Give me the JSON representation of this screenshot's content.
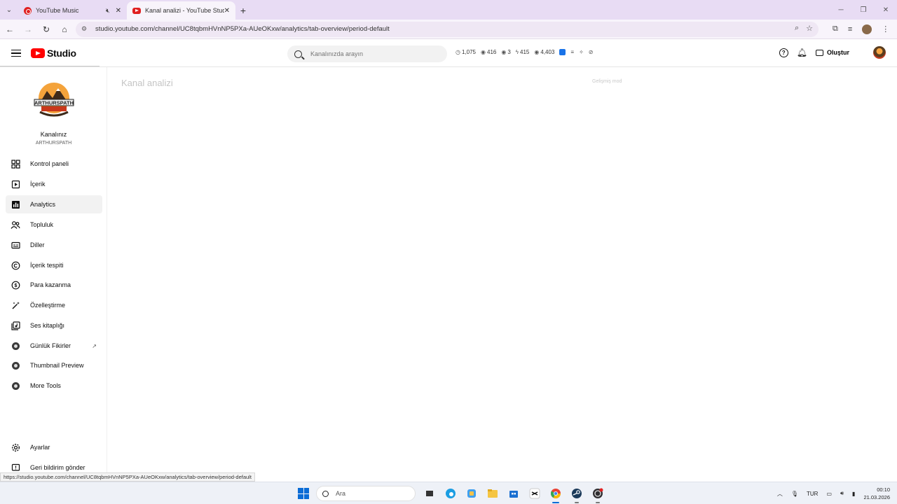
{
  "browser": {
    "tabs": [
      {
        "title": "YouTube Music",
        "icon": "youtube-music-icon",
        "muted": true
      },
      {
        "title": "Kanal analizi - YouTube Studio",
        "icon": "youtube-icon",
        "active": true
      }
    ],
    "url": "studio.youtube.com/channel/UC8tqbmHVnNP5PXa-AUeOKxw/analytics/tab-overview/period-default"
  },
  "studio": {
    "logo_text": "Studio",
    "search_placeholder": "Kanalınızda arayın",
    "stats": [
      {
        "icon": "clock-icon",
        "value": "1,075"
      },
      {
        "icon": "eye-icon",
        "value": "416"
      },
      {
        "icon": "eye-icon",
        "value": "3"
      },
      {
        "icon": "bolt-icon",
        "value": "415"
      },
      {
        "icon": "eye-icon",
        "value": "4,403"
      }
    ],
    "create_label": "Oluştur"
  },
  "sidebar": {
    "channel_title": "Kanalınız",
    "channel_handle": "ARTHURSPATH",
    "logo_text": "ARTHURSPATH",
    "items": [
      {
        "label": "Kontrol paneli",
        "icon": "dashboard-icon"
      },
      {
        "label": "İçerik",
        "icon": "content-icon"
      },
      {
        "label": "Analytics",
        "icon": "analytics-icon",
        "active": true
      },
      {
        "label": "Topluluk",
        "icon": "community-icon"
      },
      {
        "label": "Diller",
        "icon": "subtitles-icon"
      },
      {
        "label": "İçerik tespiti",
        "icon": "copyright-icon"
      },
      {
        "label": "Para kazanma",
        "icon": "dollar-icon"
      },
      {
        "label": "Özelleştirme",
        "icon": "magic-wand-icon"
      },
      {
        "label": "Ses kitaplığı",
        "icon": "audio-library-icon"
      },
      {
        "label": "Günlük Fikirler",
        "icon": "extension-icon"
      },
      {
        "label": "Thumbnail Preview",
        "icon": "extension-icon"
      },
      {
        "label": "More Tools",
        "icon": "extension-icon"
      }
    ],
    "settings_label": "Ayarlar",
    "feedback_label": "Geri bildirim gönder"
  },
  "main": {
    "page_title": "Kanal analizi",
    "advanced_mode": "Gelişmiş mod"
  },
  "status_url": "https://studio.youtube.com/channel/UC8tqbmHVnNP5PXa-AUeOKxw/analytics/tab-overview/period-default",
  "taskbar": {
    "search_placeholder": "Ara",
    "lang": "TUR",
    "time": "00:10",
    "date": "21.03.2026"
  }
}
